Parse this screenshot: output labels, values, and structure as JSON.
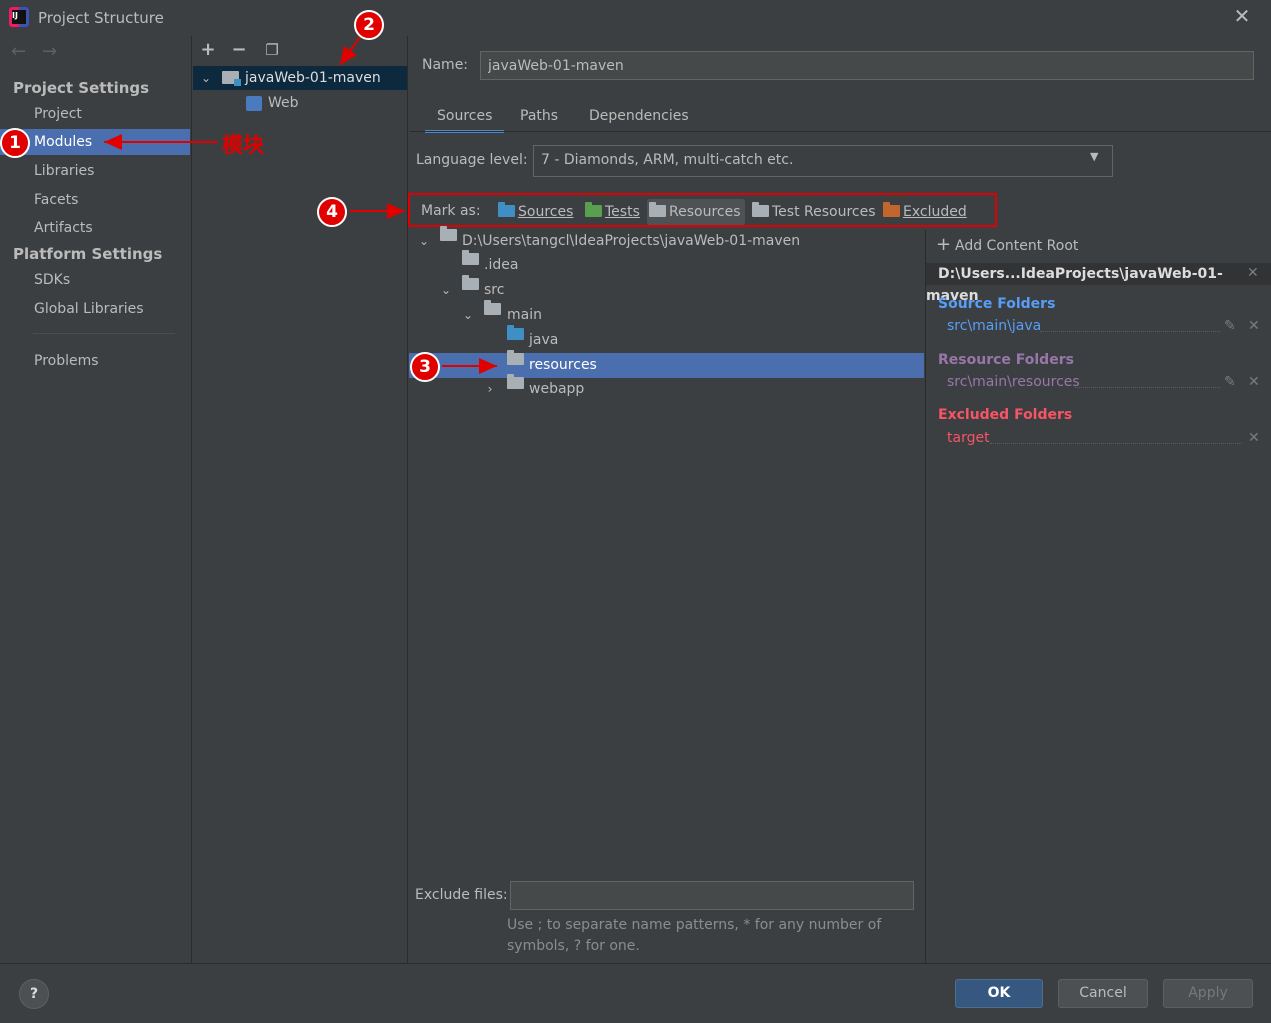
{
  "window": {
    "title": "Project Structure"
  },
  "nav": {
    "project_settings_header": "Project Settings",
    "platform_settings_header": "Platform Settings",
    "items": [
      {
        "label": "Project"
      },
      {
        "label": "Modules"
      },
      {
        "label": "Libraries"
      },
      {
        "label": "Facets"
      },
      {
        "label": "Artifacts"
      }
    ],
    "platform_items": [
      {
        "label": "SDKs"
      },
      {
        "label": "Global Libraries"
      }
    ],
    "problems": "Problems"
  },
  "module_tree": {
    "module": "javaWeb-01-maven",
    "facet": "Web"
  },
  "module": {
    "name_label": "Name:",
    "name_value": "javaWeb-01-maven",
    "tabs": [
      {
        "label": "Sources"
      },
      {
        "label": "Paths"
      },
      {
        "label": "Dependencies"
      }
    ],
    "language_level_label": "Language level:",
    "language_level_value": "7 - Diamonds, ARM, multi-catch etc.",
    "mark_as_label": "Mark as:",
    "mark_as": [
      {
        "label": "Sources"
      },
      {
        "label": "Tests"
      },
      {
        "label": "Resources"
      },
      {
        "label": "Test Resources"
      },
      {
        "label": "Excluded"
      }
    ],
    "tree": [
      {
        "label": "D:\\Users\\tangcl\\IdeaProjects\\javaWeb-01-maven"
      },
      {
        "label": ".idea"
      },
      {
        "label": "src"
      },
      {
        "label": "main"
      },
      {
        "label": "java"
      },
      {
        "label": "resources"
      },
      {
        "label": "webapp"
      }
    ],
    "exclude_files_label": "Exclude files:",
    "exclude_files_value": "",
    "exclude_hint_line1": "Use ; to separate name patterns, * for any number of",
    "exclude_hint_line2": "symbols, ? for one."
  },
  "content_roots": {
    "add_label": "Add Content Root",
    "root_path": "D:\\Users...IdeaProjects\\javaWeb-01-maven",
    "source_folders_label": "Source Folders",
    "source_folder": "src\\main\\java",
    "resource_folders_label": "Resource Folders",
    "resource_folder": "src\\main\\resources",
    "excluded_folders_label": "Excluded Folders",
    "excluded_folder": "target"
  },
  "buttons": {
    "ok": "OK",
    "cancel": "Cancel",
    "apply": "Apply",
    "help": "?"
  },
  "annotations": {
    "b1": "1",
    "b2": "2",
    "b3": "3",
    "b4": "4",
    "modules_note": "模块"
  },
  "colors": {
    "accent": "#4b6eaf",
    "annotation": "#e00000",
    "source": "#589df6",
    "resource": "#9876aa",
    "excluded": "#f75464"
  }
}
